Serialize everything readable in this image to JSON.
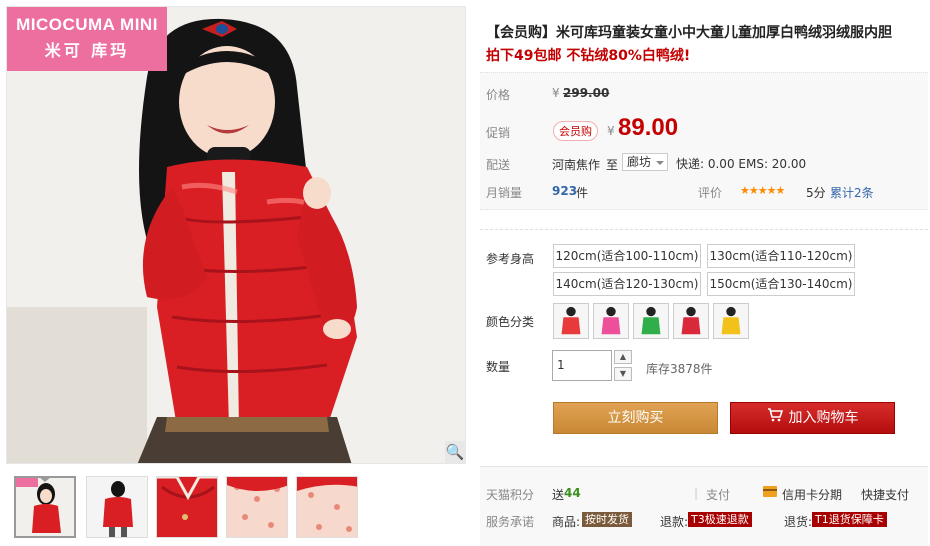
{
  "brand": {
    "line1": "MICOCUMA MINI",
    "line2": "米可 库玛"
  },
  "title": "【会员购】米可库玛童装女童小中大童儿童加厚白鸭绒羽绒服内胆",
  "subtitle": "拍下49包邮 不钻绒80%白鸭绒!",
  "price": {
    "label": "价格",
    "currency": "¥",
    "original": "299.00",
    "promo_label": "促销",
    "promo_badge": "会员购",
    "promo_price": "89.00"
  },
  "shipping": {
    "label": "配送",
    "from": "河南焦作",
    "to_word": "至",
    "dest": "廊坊",
    "fee": "快递: 0.00 EMS: 20.00"
  },
  "sales": {
    "label": "月销量",
    "count": "923",
    "unit": "件",
    "rating_label": "评价",
    "stars": "★★★★★",
    "score": "5分",
    "reviews": "累计2条"
  },
  "size": {
    "label": "参考身高",
    "options": [
      "120cm(适合100-110cm)",
      "130cm(适合110-120cm)",
      "140cm(适合120-130cm)",
      "150cm(适合130-140cm)"
    ]
  },
  "color": {
    "label": "颜色分类",
    "swatches": [
      "#e83a3a",
      "#ee4f9a",
      "#2fae4a",
      "#d8283a",
      "#f3c21a"
    ]
  },
  "quantity": {
    "label": "数量",
    "value": "1",
    "up": "▲",
    "down": "▼",
    "stock": "库存3878件"
  },
  "buttons": {
    "buy": "立刻购买",
    "cart": "加入购物车"
  },
  "services": {
    "points_label": "天猫积分",
    "points_prefix": "送",
    "points_value": "44",
    "pay_label": "支付",
    "credit": "信用卡分期",
    "fast_pay": "快捷支付",
    "promise_label": "服务承诺",
    "goods_label": "商品:",
    "goods_tag": "按时发货",
    "refund_label": "退款:",
    "refund_tag": "T3极速退款",
    "return_label": "退货:",
    "return_tag": "T1退货保障卡"
  },
  "colors": {
    "accent_red": "#c40000",
    "buy_orange": "#d99a4a",
    "cart_red": "#c41a1a",
    "brand_pink": "#ec6fa0"
  }
}
